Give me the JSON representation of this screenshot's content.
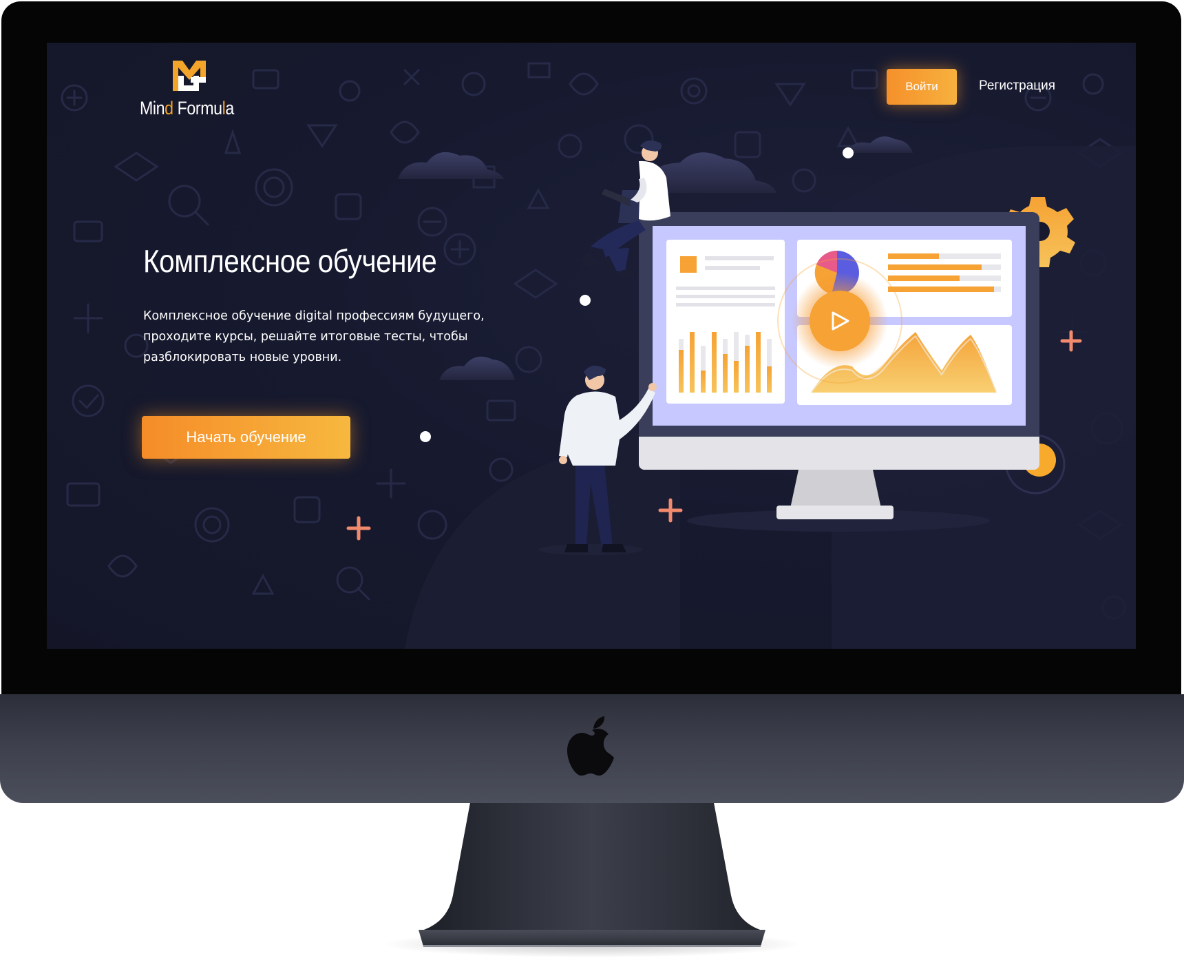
{
  "brand": {
    "name_part1": "Min",
    "name_part2": "d",
    "name_part3": " Formu",
    "name_part4": "l",
    "name_part5": "a"
  },
  "nav": {
    "login_label": "Войти",
    "register_label": "Регистрация"
  },
  "hero": {
    "title": "Комплексное обучение",
    "description": "Комплексное обучение digital профессиям будущего, проходите курсы, решайте итоговые тесты, чтобы разблокировать новые уровни.",
    "cta_label": "Начать обучение"
  },
  "colors": {
    "background": "#171a2f",
    "accent_orange": "#f5902a",
    "accent_yellow": "#f7b83f",
    "text": "#ffffff",
    "device_bezel": "#050506",
    "device_chin": "#3d404c"
  },
  "icons": [
    "mind-formula-logo-icon",
    "apple-logo-icon",
    "play-icon",
    "gear-icon",
    "plus-icon"
  ]
}
